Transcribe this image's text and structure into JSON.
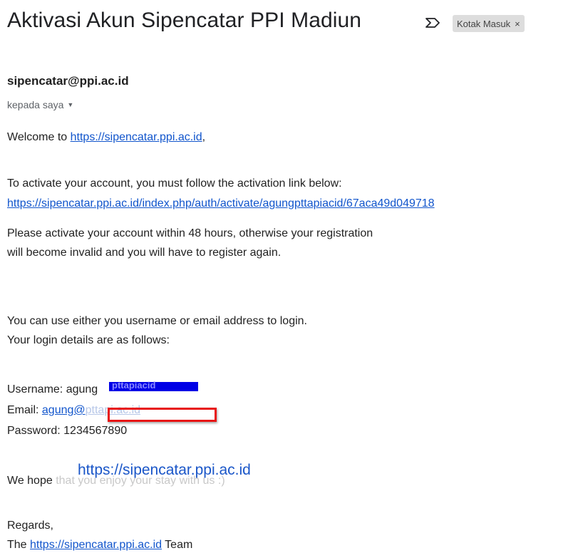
{
  "email": {
    "subject": "Aktivasi Akun Sipencatar PPI Madiun",
    "label": "Kotak Masuk",
    "label_close": "×",
    "sender": "sipencatar@ppi.ac.id",
    "to": "kepada saya",
    "icons": [
      "important-marker-icon",
      "chevron-down-icon",
      "close-icon"
    ]
  },
  "body": {
    "welcome_prefix": "Welcome to ",
    "welcome_link": "https://sipencatar.ppi.ac.id",
    "welcome_suffix": ",",
    "activate_intro": "To activate your account, you must follow the activation link below:",
    "activation_link": "https://sipencatar.ppi.ac.id/index.php/auth/activate/agungpttapiacid/67aca49d049718",
    "deadline_line1": "Please activate your account within 48 hours, otherwise your registration",
    "deadline_line2": "will become invalid and you will have to register again.",
    "login_line1": "You can use either you username or email address to login.",
    "login_line2": "Your login details are as follows:",
    "username_label": "Username: agung",
    "username_redacted": "pttapiacid",
    "email_label": "Email: ",
    "email_link": "agung@",
    "email_hidden": "pttapi.ac.id",
    "password_label": "Password: 1234567890",
    "hope_visible": "We hope",
    "hope_hidden": " that you enjoy your stay with us :)",
    "overlay_url": "https://sipencatar.ppi.ac.id",
    "regards": "Regards,",
    "team_prefix": "The ",
    "team_link": "https://sipencatar.ppi.ac.id",
    "team_suffix": " Team"
  },
  "colors": {
    "link": "#1155cc",
    "redact_blue": "#0000e6",
    "redact_red": "#e81515",
    "label_chip": "#dddddd"
  }
}
